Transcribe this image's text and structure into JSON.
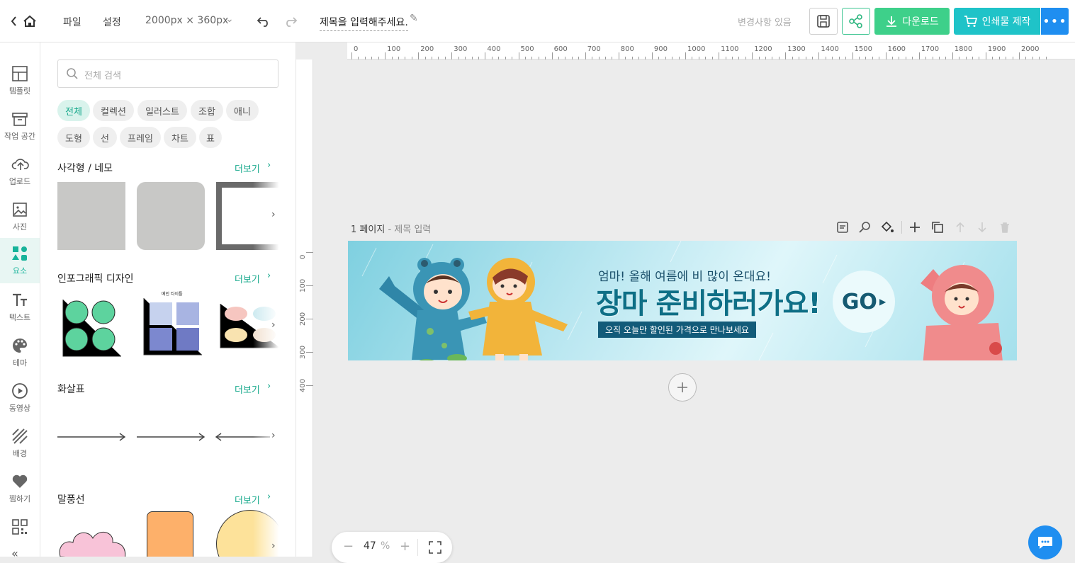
{
  "topbar": {
    "file": "파일",
    "settings": "설정",
    "size": "2000px × 360px",
    "doc_title": "제목을 입력해주세요.",
    "status": "변경사항 있음",
    "download": "다운로드",
    "print": "인쇄물 제작"
  },
  "leftbar": {
    "items": [
      {
        "label": "템플릿",
        "icon": "template-icon"
      },
      {
        "label": "작업 공간",
        "icon": "workspace-icon"
      },
      {
        "label": "업로드",
        "icon": "upload-icon"
      },
      {
        "label": "사진",
        "icon": "photo-icon"
      },
      {
        "label": "요소",
        "icon": "elements-icon"
      },
      {
        "label": "텍스트",
        "icon": "text-icon"
      },
      {
        "label": "테마",
        "icon": "palette-icon"
      },
      {
        "label": "동영상",
        "icon": "video-icon"
      },
      {
        "label": "배경",
        "icon": "background-icon"
      },
      {
        "label": "찜하기",
        "icon": "heart-icon"
      }
    ]
  },
  "panel": {
    "search_placeholder": "전체 검색",
    "chips": [
      "전체",
      "컬렉션",
      "일러스트",
      "조합",
      "애니",
      "도형",
      "선",
      "프레임",
      "차트",
      "표"
    ],
    "sections": [
      {
        "title": "사각형 / 네모",
        "more": "더보기"
      },
      {
        "title": "인포그래픽 디자인",
        "more": "더보기"
      },
      {
        "title": "화살표",
        "more": "더보기"
      },
      {
        "title": "말풍선",
        "more": "더보기"
      }
    ],
    "infographic_thumb_title": "메인 타이틀"
  },
  "ruler": {
    "h_labels": [
      "0",
      "100",
      "200",
      "300",
      "400",
      "500",
      "600",
      "700",
      "800",
      "900",
      "1000",
      "1100",
      "1200",
      "1300",
      "1400",
      "1500",
      "1600",
      "1700",
      "1800",
      "1900",
      "2000"
    ],
    "v_labels": [
      "0",
      "100",
      "200",
      "300",
      "400"
    ]
  },
  "page": {
    "number": "1 페이지",
    "subtitle": "- 제목 입력"
  },
  "banner": {
    "small_text": "엄마! 올해 여름에 비 많이 온대요!",
    "headline": "장마 준비하러가요!",
    "tag": "오직 오늘만 할인된 가격으로 만나보세요",
    "go": "GO"
  },
  "zoom": {
    "value": "47",
    "unit": "%"
  },
  "colors": {
    "accent": "#17b39a",
    "download_green": "#3ed08a",
    "print_teal": "#1fc3c8",
    "more_blue": "#1f8ef0"
  }
}
